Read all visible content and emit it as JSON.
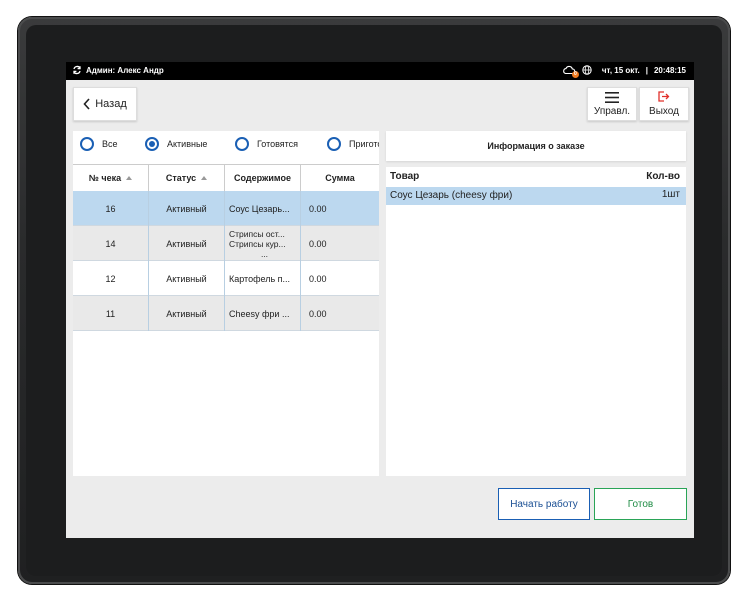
{
  "status_bar": {
    "user_label": "Админ: Алекс Андр",
    "date": "чт, 15 окт.",
    "time": "20:48:15",
    "sync_badge": "0"
  },
  "toolbar": {
    "back_label": "Назад",
    "manage_label": "Управл.",
    "exit_label": "Выход"
  },
  "filters": [
    {
      "label": "Все",
      "selected": false
    },
    {
      "label": "Активные",
      "selected": true
    },
    {
      "label": "Готовятся",
      "selected": false
    },
    {
      "label": "Пригото",
      "selected": false
    }
  ],
  "orders_table": {
    "columns": [
      "№ чека",
      "Статус",
      "Содержимое",
      "Сумма"
    ],
    "rows": [
      {
        "number": "16",
        "status": "Активный",
        "content": [
          "Соус Цезарь..."
        ],
        "sum": "0.00",
        "selected": true
      },
      {
        "number": "14",
        "status": "Активный",
        "content": [
          "Стрипсы ост...",
          "Стрипсы кур...",
          "..."
        ],
        "sum": "0.00",
        "selected": false
      },
      {
        "number": "12",
        "status": "Активный",
        "content": [
          "Картофель п..."
        ],
        "sum": "0.00",
        "selected": false
      },
      {
        "number": "11",
        "status": "Активный",
        "content": [
          "Cheesy фри ..."
        ],
        "sum": "0.00",
        "selected": false
      }
    ]
  },
  "order_info": {
    "title": "Информация о заказе",
    "columns": [
      "Товар",
      "Кол-во"
    ],
    "items": [
      {
        "name": "Соус Цезарь (cheesy фри)",
        "qty": "1шт"
      }
    ]
  },
  "actions": {
    "start_label": "Начать работу",
    "done_label": "Готов"
  },
  "colors": {
    "accent_blue": "#1a5fb4",
    "accent_green": "#2aa457",
    "selected_row": "#bcd8ef",
    "alt_row": "#e9e9e9"
  }
}
